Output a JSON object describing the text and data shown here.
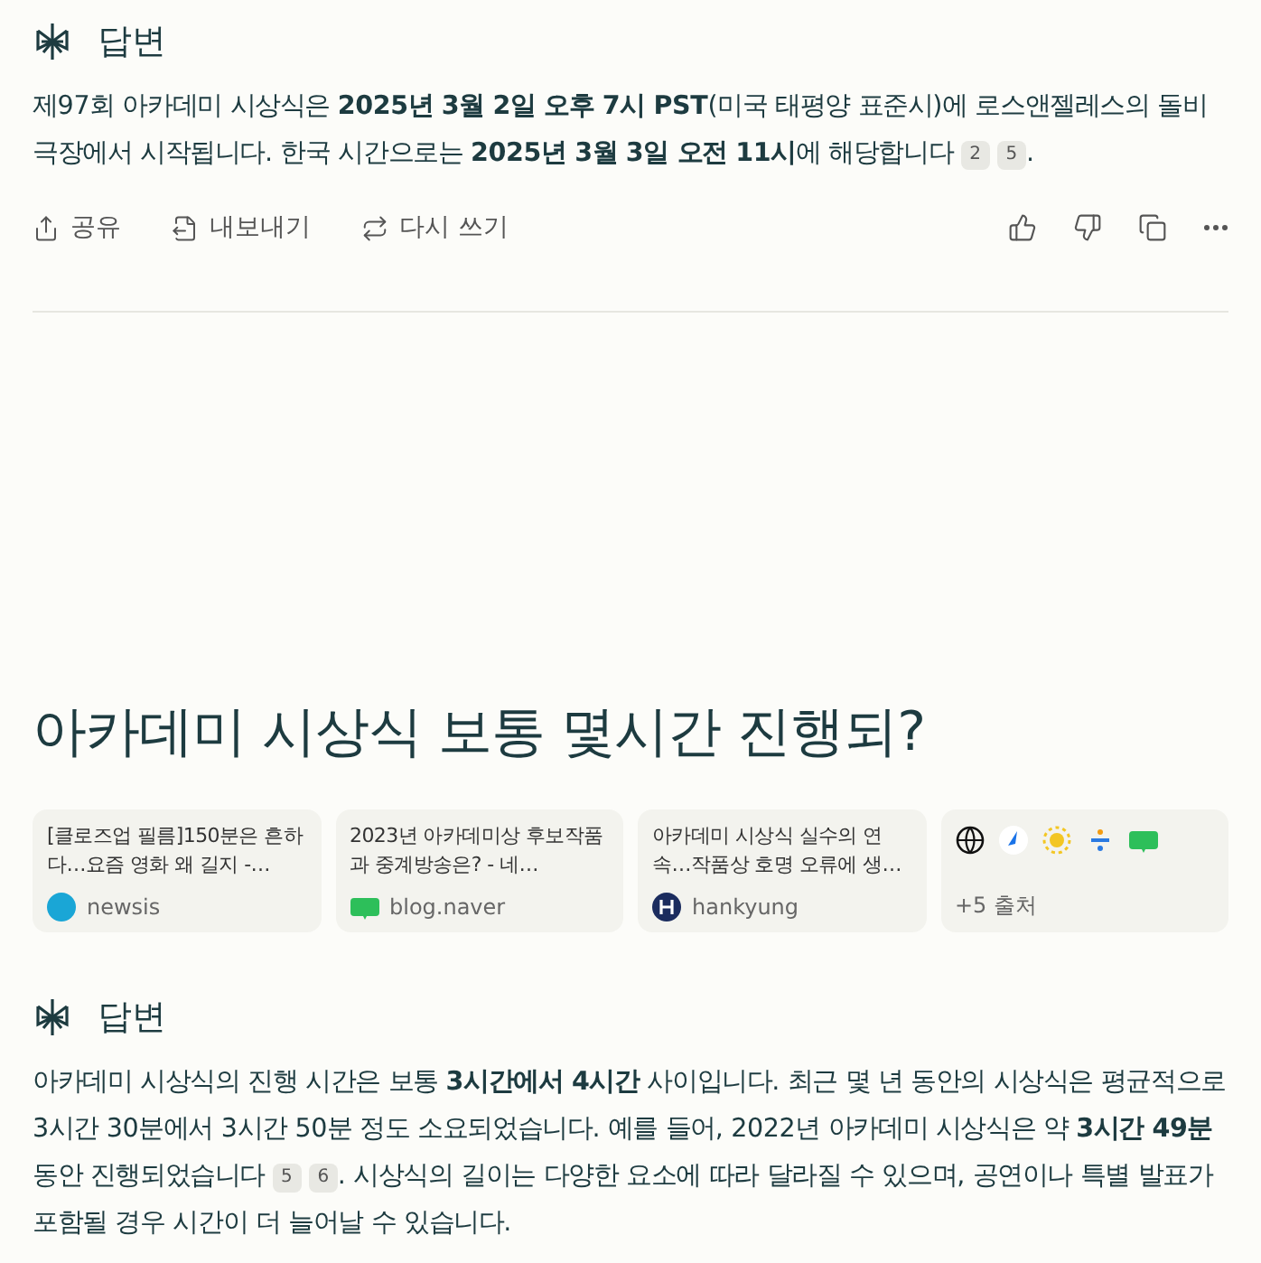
{
  "answer_1": {
    "header": "답변",
    "paragraph": [
      {
        "kind": "text",
        "text": "제97회 아카데미 시상식은 **2025년 3월 2일 오후 7시 PST**(미국 태평양 표준시)에 로스앤젤레스의 돌비 극장에서 시작됩니다. 한국 시간으로는 **2025년 3월 3일 오전 11시**에 해당합니다"
      },
      {
        "kind": "cite",
        "text": "2"
      },
      {
        "kind": "cite",
        "text": "5"
      },
      {
        "kind": "text",
        "text": "."
      }
    ],
    "actions": [
      {
        "kind": "share",
        "label": "공유"
      },
      {
        "kind": "export",
        "label": "내보내기"
      },
      {
        "kind": "rewrite",
        "label": "다시 쓰기"
      }
    ],
    "icon_actions": [
      {
        "kind": "like"
      },
      {
        "kind": "dislike"
      },
      {
        "kind": "copy"
      },
      {
        "kind": "more"
      }
    ]
  },
  "question": "아카데미 시상식 보통 몇시간 진행되?",
  "sources": [
    {
      "kind": "source",
      "title": "[클로즈업 필름]150분은 흔하다…요즘 영화 왜 길지 -…",
      "site": "newsis"
    },
    {
      "kind": "source",
      "title": "2023년 아카데미상 후보작품과 중계방송은? - 네…",
      "site": "blog.naver"
    },
    {
      "kind": "source",
      "title": "아카데미 시상식 실수의 연속…작품상 호명 오류에 생…",
      "site": "hankyung"
    },
    {
      "kind": "more",
      "label": "+5 출처"
    }
  ],
  "answer_2": {
    "header": "답변",
    "paragraph": [
      {
        "kind": "text",
        "text": "아카데미 시상식의 진행 시간은 보통 **3시간에서 4시간** 사이입니다. 최근 몇 년 동안의 시상식은 평균적으로 3시간 30분에서 3시간 50분 정도 소요되었습니다. 예를 들어, 2022년 아카데미 시상식은 약 **3시간 49분** 동안 진행되었습니다"
      },
      {
        "kind": "cite",
        "text": "5"
      },
      {
        "kind": "cite",
        "text": "6"
      },
      {
        "kind": "text",
        "text": ". 시상식의 길이는 다양한 요소에 따라 달라질 수 있으며, 공연이나 특별 발표가 포함될 경우 시간이 더 늘어날 수 있습니다."
      }
    ]
  }
}
